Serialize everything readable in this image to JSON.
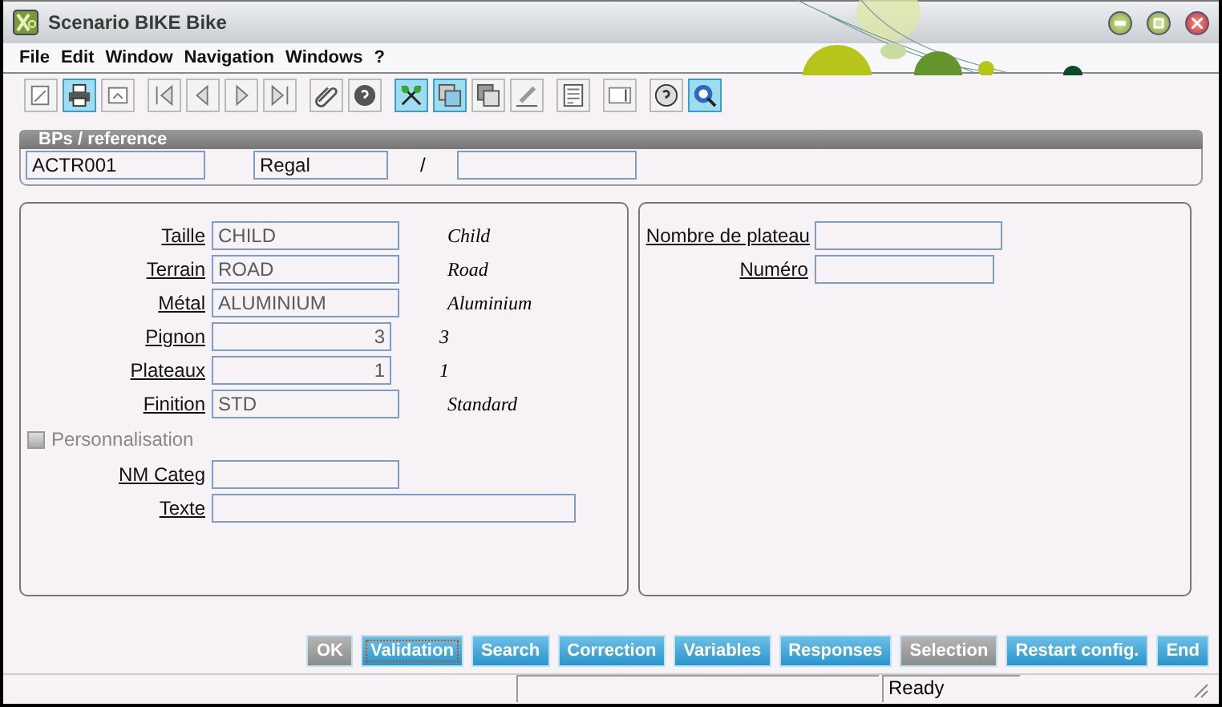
{
  "window": {
    "title": "Scenario BIKE Bike"
  },
  "menu": [
    {
      "label": "File"
    },
    {
      "label": "Edit"
    },
    {
      "label": "Window"
    },
    {
      "label": "Navigation"
    },
    {
      "label": "Windows"
    },
    {
      "label": "?"
    }
  ],
  "toolbar": [
    [
      {
        "kind": "page",
        "highlighted": false
      },
      {
        "kind": "print",
        "highlighted": true
      },
      {
        "kind": "mail",
        "highlighted": false
      }
    ],
    [
      {
        "kind": "first",
        "highlighted": false
      },
      {
        "kind": "prev",
        "highlighted": false
      },
      {
        "kind": "next",
        "highlighted": false
      },
      {
        "kind": "last",
        "highlighted": false
      }
    ],
    [
      {
        "kind": "clip",
        "highlighted": false
      },
      {
        "kind": "help",
        "highlighted": false
      }
    ],
    [
      {
        "kind": "scissors",
        "highlighted": true
      },
      {
        "kind": "window",
        "highlighted": true
      },
      {
        "kind": "windows",
        "highlighted": false
      },
      {
        "kind": "sign",
        "highlighted": false
      }
    ],
    [
      {
        "kind": "document",
        "highlighted": false
      }
    ],
    [
      {
        "kind": "text",
        "highlighted": false
      }
    ],
    [
      {
        "kind": "question",
        "highlighted": false
      },
      {
        "kind": "globe",
        "highlighted": true
      }
    ]
  ],
  "reference": {
    "title": "BPs / reference",
    "fields": [
      {
        "kind": "field",
        "value": "ACTR001"
      },
      {
        "kind": "field",
        "value": "Regal"
      },
      {
        "kind": "separator",
        "text": "/"
      },
      {
        "kind": "field"
      }
    ]
  },
  "left_panel": [
    {
      "kind": "text",
      "label": "Taille",
      "value": "CHILD",
      "description": "Child"
    },
    {
      "kind": "text",
      "label": "Terrain",
      "value": "ROAD",
      "description": "Road"
    },
    {
      "kind": "text",
      "label": "Métal",
      "value": "ALUMINIUM",
      "description": "Aluminium"
    },
    {
      "kind": "number",
      "label": "Pignon",
      "value": "3",
      "description": "3"
    },
    {
      "kind": "number",
      "label": "Plateaux",
      "value": "1",
      "description": "1"
    },
    {
      "kind": "text",
      "label": "Finition",
      "value": "STD",
      "description": "Standard"
    },
    {
      "kind": "checkbox",
      "label": "Personnalisation",
      "checked": false,
      "disabled": true
    },
    {
      "kind": "text",
      "label": "NM Categ"
    },
    {
      "kind": "long",
      "label": "Texte"
    }
  ],
  "right_panel": [
    {
      "kind": "text",
      "label": "Nombre de plateau"
    },
    {
      "kind": "number",
      "label": "Numéro"
    }
  ],
  "buttons": [
    {
      "label": "OK",
      "disabled": true,
      "focused": false
    },
    {
      "label": "Validation",
      "disabled": false,
      "focused": true
    },
    {
      "label": "Search",
      "disabled": false,
      "focused": false
    },
    {
      "label": "Correction",
      "disabled": false,
      "focused": false
    },
    {
      "label": "Variables",
      "disabled": false,
      "focused": false
    },
    {
      "label": "Responses",
      "disabled": false,
      "focused": false
    },
    {
      "label": "Selection",
      "disabled": true,
      "focused": false
    },
    {
      "label": "Restart config.",
      "disabled": false,
      "focused": false
    },
    {
      "label": "End",
      "disabled": false,
      "focused": false
    }
  ],
  "status_bar": {
    "message": "Ready"
  }
}
